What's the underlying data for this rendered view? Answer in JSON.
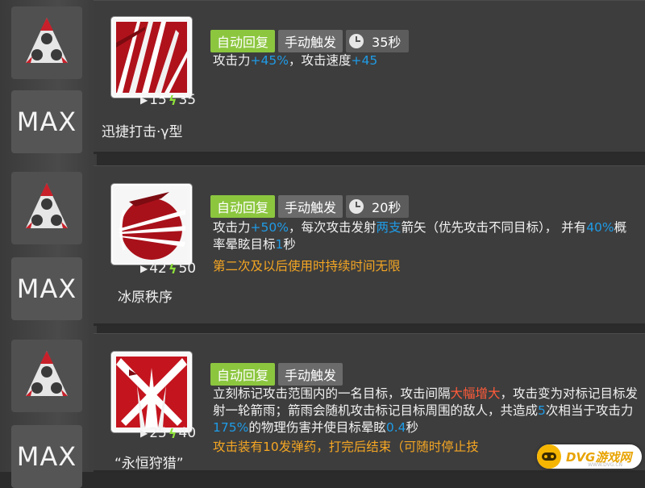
{
  "skills": [
    {
      "max_label": "MAX",
      "icon": "skill-icon-swift-strike",
      "cost_initial": "15",
      "cost_sp": "35",
      "name": "迅捷打击·γ型",
      "tags": {
        "auto": "自动回复",
        "manual": "手动触发",
        "duration": "35秒"
      },
      "desc_parts": [
        {
          "t": "攻击力",
          "c": ""
        },
        {
          "t": "+45%",
          "c": "blue"
        },
        {
          "t": "，攻击速度",
          "c": ""
        },
        {
          "t": "+45",
          "c": "blue"
        }
      ]
    },
    {
      "max_label": "MAX",
      "icon": "skill-icon-frost-order",
      "cost_initial": "42",
      "cost_sp": "50",
      "name": "冰原秩序",
      "tags": {
        "auto": "自动回复",
        "manual": "手动触发",
        "duration": "20秒"
      },
      "desc_parts": [
        {
          "t": "攻击力",
          "c": ""
        },
        {
          "t": "+50%",
          "c": "blue"
        },
        {
          "t": "，每次攻击发射",
          "c": ""
        },
        {
          "t": "两支",
          "c": "blue"
        },
        {
          "t": "箭矢（优先攻击不同目标）， 并有",
          "c": ""
        },
        {
          "t": "40%",
          "c": "blue"
        },
        {
          "t": "概率晕眩目标",
          "c": ""
        },
        {
          "t": "1",
          "c": "blue"
        },
        {
          "t": "秒",
          "c": ""
        }
      ],
      "note": "第二次及以后使用时持续时间无限"
    },
    {
      "max_label": "MAX",
      "icon": "skill-icon-eternal-hunt",
      "cost_initial": "25",
      "cost_sp": "40",
      "name": "“永恒狩猎”",
      "tags": {
        "auto": "自动回复",
        "manual": "手动触发"
      },
      "desc_parts": [
        {
          "t": "立刻标记攻击范围内的一名目标，攻击间隔",
          "c": ""
        },
        {
          "t": "大幅增大",
          "c": "red"
        },
        {
          "t": "，攻击变为对标记目标发射一轮箭雨；箭雨会随机攻击标记目标周围的敌人，共造成",
          "c": ""
        },
        {
          "t": "5",
          "c": "blue"
        },
        {
          "t": "次相当于攻击力",
          "c": ""
        },
        {
          "t": "175%",
          "c": "blue"
        },
        {
          "t": "的物理伤害并使目标晕眩",
          "c": ""
        },
        {
          "t": "0.4",
          "c": "blue"
        },
        {
          "t": "秒",
          "c": ""
        }
      ],
      "note": "攻击装有10发弹药，打完后结束（可随时停止技"
    }
  ],
  "watermark": {
    "brand": "DVG游戏网",
    "url": "WWW.DVG.CN"
  },
  "colors": {
    "auto_tag": "#8cc63f",
    "highlight_blue": "#1f9be6",
    "highlight_red": "#ff5b3a",
    "note_orange": "#f5a623"
  }
}
